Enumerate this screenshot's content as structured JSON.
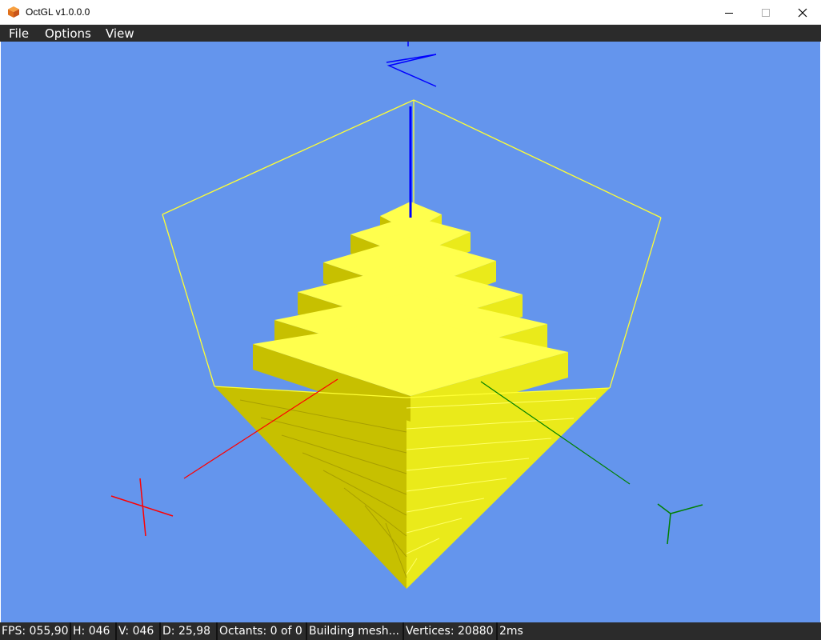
{
  "window": {
    "title": "OctGL v1.0.0.0",
    "controls": {
      "minimize": "─",
      "maximize": "☐",
      "close": "✕"
    }
  },
  "menu": {
    "items": [
      "File",
      "Options",
      "View"
    ]
  },
  "viewport": {
    "background": "#6495ed",
    "solid_color": "#e8e000",
    "bbox_color": "#ffff33",
    "axis_colors": {
      "x": "#ff0000",
      "y": "#008000",
      "z": "#0000ff"
    },
    "gizmo_labels": [
      "X",
      "Y",
      "Z"
    ]
  },
  "status": {
    "fps": "FPS: 055,90",
    "h": "H: 046",
    "v": "V: 046",
    "d": "D: 25,98",
    "octants": "Octants: 0 of 0",
    "state": "Building mesh...",
    "vertices": "Vertices: 20880",
    "time": "2ms"
  }
}
